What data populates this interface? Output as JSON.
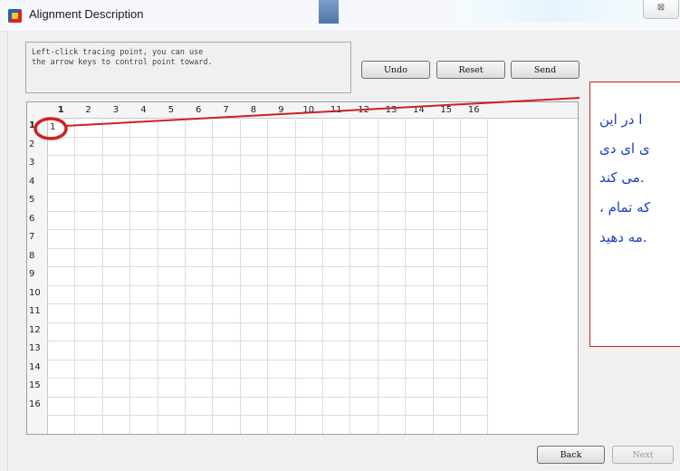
{
  "window": {
    "title": "Alignment Description",
    "close_glyph": "⊠"
  },
  "instructions": [
    "Left-click tracing point, you can use",
    "the arrow keys to control point toward."
  ],
  "toolbar": {
    "undo": "Undo",
    "reset": "Reset",
    "send": "Send"
  },
  "grid": {
    "columns": [
      "1",
      "2",
      "3",
      "4",
      "5",
      "6",
      "7",
      "8",
      "9",
      "10",
      "11",
      "12",
      "13",
      "14",
      "15",
      "16"
    ],
    "rows": [
      "1",
      "2",
      "3",
      "4",
      "5",
      "6",
      "7",
      "8",
      "9",
      "10",
      "11",
      "12",
      "13",
      "14",
      "15",
      "16"
    ],
    "selected_row": "1",
    "selected_col": "1",
    "cell_value": "1"
  },
  "annotation": {
    "color": "#d02020",
    "text_color": "#1a3fbf",
    "lines": [
      "ا در این",
      "ی ای دی",
      "می کند.",
      "، که تمام",
      "مه دهید."
    ]
  },
  "footer": {
    "back": "Back",
    "next": "Next"
  }
}
